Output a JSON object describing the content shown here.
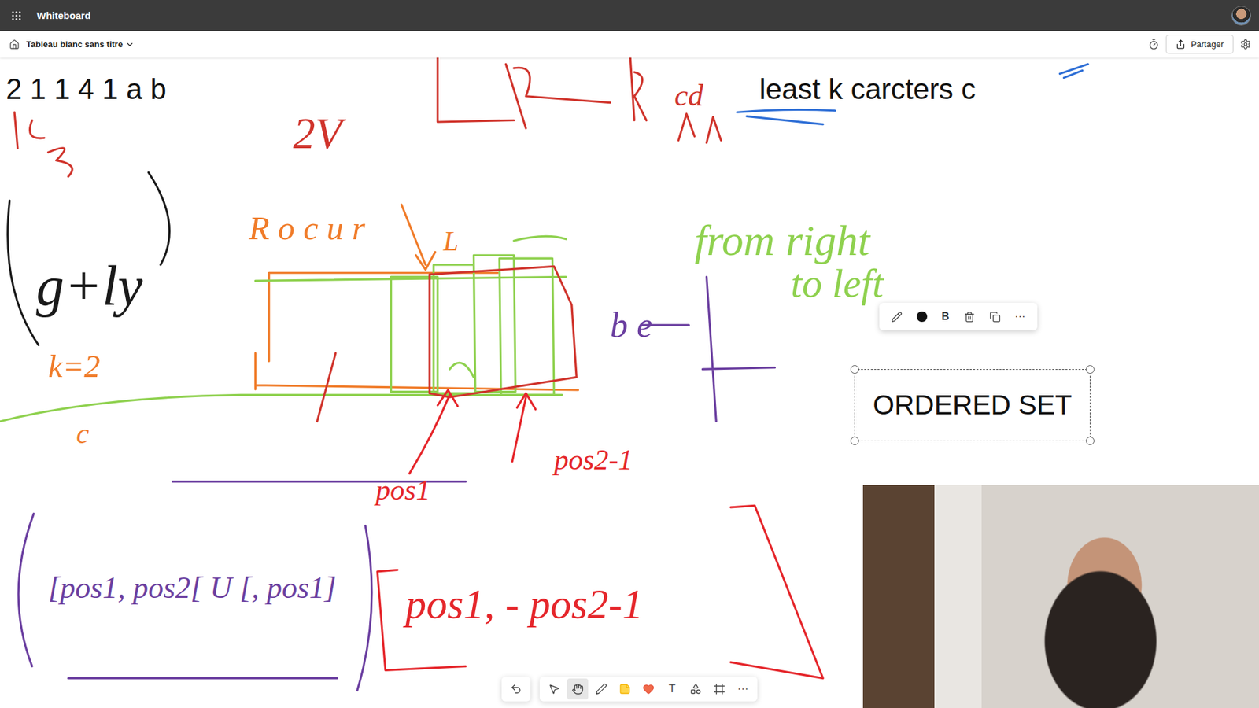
{
  "app": {
    "title": "Whiteboard"
  },
  "breadcrumb": {
    "board": "Tableau blanc sans titre"
  },
  "share": {
    "label": "Partager"
  },
  "canvas_texts": [
    {
      "text": "2 1 1 4 1 a b",
      "selected": false
    },
    {
      "text": "least k carcters c",
      "selected": false
    },
    {
      "text": "ORDERED SET",
      "selected": true
    }
  ],
  "ink_labels": [
    {
      "text": "2V",
      "color": "#d0342c"
    },
    {
      "text": "cd",
      "color": "#d0342c"
    },
    {
      "text": "R o c u r",
      "color": "#f07c2a"
    },
    {
      "text": "L",
      "color": "#f07c2a"
    },
    {
      "text": "k=2",
      "color": "#f07c2a"
    },
    {
      "text": "c",
      "color": "#f07c2a"
    },
    {
      "text": "g+ly",
      "color": "#1a1a1a"
    },
    {
      "text": "from right",
      "color": "#8fd14f"
    },
    {
      "text": "to left",
      "color": "#8fd14f"
    },
    {
      "text": "b e",
      "color": "#6b3fa0"
    },
    {
      "text": "pos1",
      "color": "#e5262b"
    },
    {
      "text": "pos2-1",
      "color": "#e5262b"
    },
    {
      "text": "[pos1, pos2[ U [, pos1]",
      "color": "#6b3fa0"
    },
    {
      "text": "pos1, - pos2-1",
      "color": "#e5262b"
    }
  ],
  "context_toolbar": [
    {
      "kind": "pencil"
    },
    {
      "kind": "color",
      "color": "#111111"
    },
    {
      "kind": "bold",
      "label": "B"
    },
    {
      "kind": "delete"
    },
    {
      "kind": "copy"
    },
    {
      "kind": "more",
      "label": "···"
    }
  ],
  "tools": [
    {
      "kind": "undo",
      "selected": false
    },
    {
      "kind": "select",
      "selected": false
    },
    {
      "kind": "pan",
      "selected": true
    },
    {
      "kind": "pen",
      "selected": false
    },
    {
      "kind": "note",
      "selected": false
    },
    {
      "kind": "reaction",
      "selected": false
    },
    {
      "kind": "text",
      "label": "T",
      "selected": false
    },
    {
      "kind": "shapes",
      "selected": false
    },
    {
      "kind": "frame",
      "selected": false
    },
    {
      "kind": "more",
      "label": "···",
      "selected": false
    }
  ]
}
